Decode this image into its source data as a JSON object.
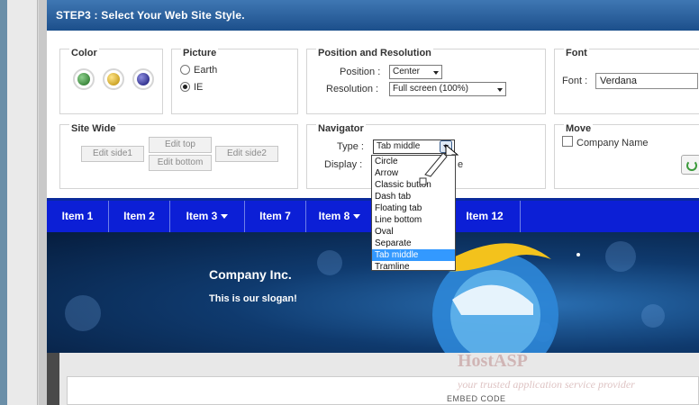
{
  "header": {
    "title": "STEP3 : Select Your Web Site Style."
  },
  "color": {
    "title": "Color",
    "swatches": [
      "green",
      "gold",
      "blue"
    ]
  },
  "picture": {
    "title": "Picture",
    "options": [
      {
        "label": "Earth",
        "checked": false
      },
      {
        "label": "IE",
        "checked": true
      }
    ]
  },
  "position_resolution": {
    "title": "Position and Resolution",
    "position_label": "Position :",
    "position_value": "Center",
    "resolution_label": "Resolution :",
    "resolution_value": "Full screen (100%)"
  },
  "font": {
    "title": "Font",
    "label": "Font :",
    "value": "Verdana"
  },
  "site_wide": {
    "title": "Site Wide",
    "edit_top": "Edit top",
    "edit_side1": "Edit side1",
    "edit_bottom": "Edit bottom",
    "edit_side2": "Edit side2"
  },
  "navigator": {
    "title": "Navigator",
    "type_label": "Type :",
    "type_value": "Tab middle",
    "display_label": "Display :",
    "display_suffix": "e",
    "options": [
      "Circle",
      "Arrow",
      "Classic button",
      "Dash tab",
      "Floating tab",
      "Line bottom",
      "Oval",
      "Separate",
      "Tab middle",
      "Tramline"
    ],
    "selected": "Tab middle"
  },
  "move": {
    "title": "Move",
    "company_name_label": "Company Name",
    "company_name_checked": false
  },
  "navbar": {
    "items": [
      {
        "label": "Item 1",
        "has_submenu": false
      },
      {
        "label": "Item 2",
        "has_submenu": false
      },
      {
        "label": "Item 3",
        "has_submenu": true
      },
      {
        "label": "Item 7",
        "has_submenu": false
      },
      {
        "label": "Item 8",
        "has_submenu": true
      },
      {
        "label": "Item 12",
        "has_submenu": false
      }
    ],
    "color": "#0c1fd6"
  },
  "banner": {
    "company": "Company Inc.",
    "slogan": "This is our slogan!"
  },
  "embed": {
    "label": "EMBED CODE"
  },
  "watermark": {
    "title": "HostASP",
    "subtitle": "your trusted application service provider"
  },
  "icons": [
    "cursor-arrow-icon",
    "refresh-icon",
    "ie-logo-icon"
  ]
}
